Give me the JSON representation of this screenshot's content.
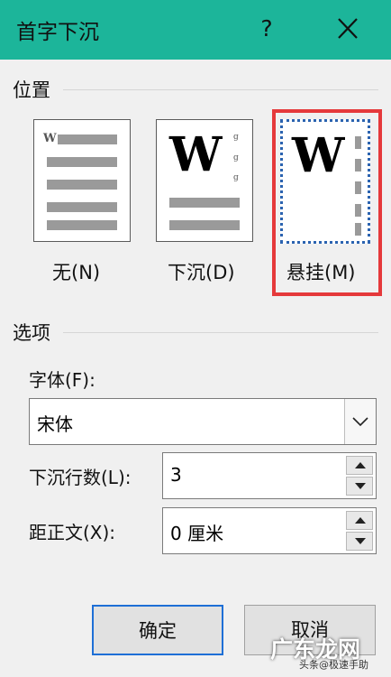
{
  "titlebar": {
    "title": "首字下沉",
    "help": "?",
    "accent": "#1cb59a"
  },
  "position_group": {
    "label": "位置",
    "options": [
      {
        "label": "无(N)",
        "mnemonic": "N"
      },
      {
        "label": "下沉(D)",
        "mnemonic": "D"
      },
      {
        "label": "悬挂(M)",
        "mnemonic": "M",
        "selected": true
      }
    ],
    "preview_letter": "W"
  },
  "options_group": {
    "label": "选项",
    "font_label": "字体(F):",
    "font_value": "宋体",
    "lines_label": "下沉行数(L):",
    "lines_value": "3",
    "distance_label": "距正文(X):",
    "distance_value": "0 厘米"
  },
  "buttons": {
    "ok": "确定",
    "cancel": "取消"
  },
  "watermark": {
    "text": "广东龙网",
    "small": "头条@极速手助"
  },
  "colors": {
    "selection_frame": "#e5393b",
    "default_button_border": "#1e6fd6"
  }
}
